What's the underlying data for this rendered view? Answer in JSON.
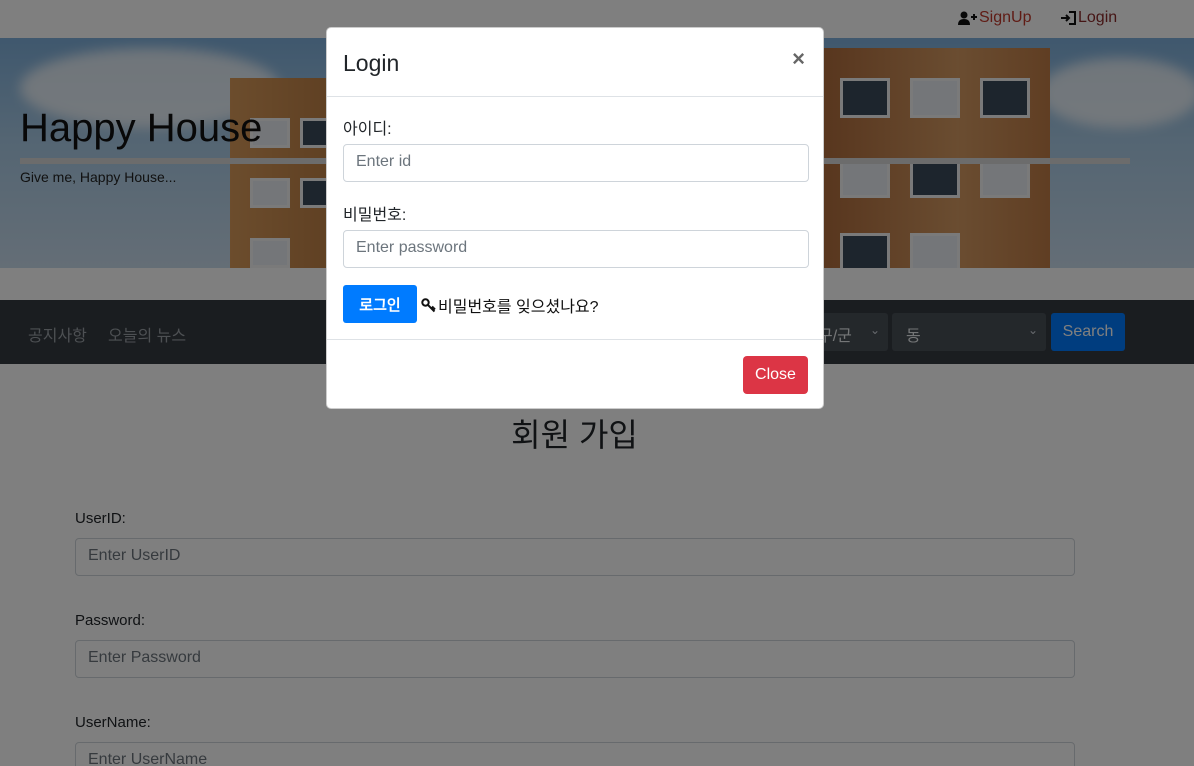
{
  "topbar": {
    "signup_label": "SignUp",
    "login_label": "Login"
  },
  "hero": {
    "title": "Happy House",
    "subtitle": "Give me, Happy House..."
  },
  "nav": {
    "items": [
      {
        "label": "공지사항"
      },
      {
        "label": "오늘의 뉴스"
      }
    ],
    "gugun_select": "구/군",
    "dong_select": "동",
    "search_label": "Search"
  },
  "signup": {
    "title": "회원 가입",
    "fields": [
      {
        "label": "UserID:",
        "placeholder": "Enter UserID"
      },
      {
        "label": "Password:",
        "placeholder": "Enter Password"
      },
      {
        "label": "UserName:",
        "placeholder": "Enter UserName"
      }
    ]
  },
  "modal": {
    "title": "Login",
    "close_symbol": "×",
    "id_label": "아이디:",
    "id_placeholder": "Enter id",
    "pw_label": "비밀번호:",
    "pw_placeholder": "Enter password",
    "login_label": "로그인",
    "forgot_label": "비밀번호를 잊으셨나요?",
    "close_label": "Close"
  },
  "colors": {
    "primary": "#007bff",
    "danger": "#dc3545",
    "navbar": "#343a40",
    "topbar_link": "#c0392b"
  },
  "icons": {
    "signup": "user-plus-icon",
    "login": "sign-in-icon",
    "forgot": "key-icon"
  }
}
